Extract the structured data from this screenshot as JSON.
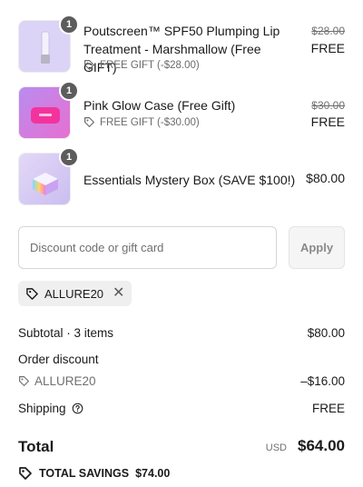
{
  "line_items": [
    {
      "title": "Poutscreen™ SPF50 Plumping Lip Treatment - Marshmallow (Free GIFT)",
      "quantity": "1",
      "tag": "FREE GIFT (-$28.00)",
      "original_price": "$28.00",
      "price": "FREE",
      "thumb_color": "#d9d2f5"
    },
    {
      "title": "Pink Glow Case (Free Gift)",
      "quantity": "1",
      "tag": "FREE GIFT (-$30.00)",
      "original_price": "$30.00",
      "price": "FREE",
      "thumb_color": "#e36bd8"
    },
    {
      "title": "Essentials Mystery Box (SAVE $100!)",
      "quantity": "1",
      "price": "$80.00",
      "thumb_color": "#d8cdf3"
    }
  ],
  "discount": {
    "placeholder": "Discount code or gift card",
    "apply_label": "Apply",
    "applied_code": "ALLURE20"
  },
  "summary": {
    "subtotal_label": "Subtotal · 3 items",
    "subtotal_value": "$80.00",
    "order_discount_label": "Order discount",
    "discount_code": "ALLURE20",
    "discount_value": "–$16.00",
    "shipping_label": "Shipping",
    "shipping_value": "FREE",
    "total_label": "Total",
    "currency": "USD",
    "total_value": "$64.00",
    "savings_label": "TOTAL SAVINGS",
    "savings_value": "$74.00"
  }
}
